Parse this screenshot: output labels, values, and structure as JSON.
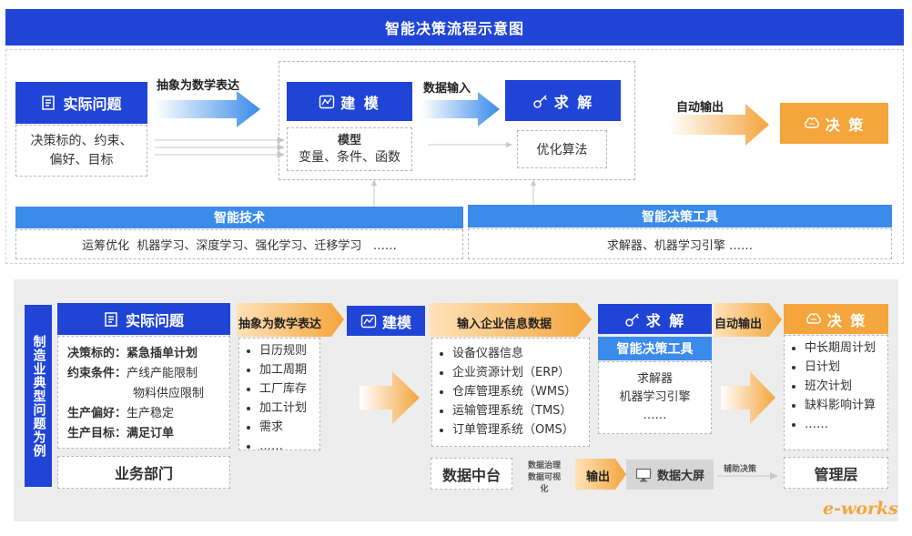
{
  "title": "智能决策流程示意图",
  "top": {
    "real_problem": {
      "title": "实际问题",
      "body_line1": "决策标的、约束、",
      "body_line2": "偏好、目标"
    },
    "abstract_label": "抽象为数学表达",
    "modeling": {
      "title": "建 模",
      "sub_title": "模型",
      "sub_body": "变量、条件、函数"
    },
    "data_input_label": "数据输入",
    "solve": {
      "title": "求 解",
      "body": "优化算法"
    },
    "auto_output_label": "自动输出",
    "decision": {
      "title": "决 策"
    },
    "smart_tech": {
      "title": "智能技术",
      "body": "运筹优化  机器学习、深度学习、强化学习、迁移学习   ……"
    },
    "smart_tools": {
      "title": "智能决策工具",
      "body": "求解器、机器学习引擎 ……"
    }
  },
  "bottom": {
    "side_label": "制造业典型问题为例",
    "real_problem": {
      "title": "实际问题",
      "rows": [
        {
          "label": "决策标的：",
          "value": "紧急插单计划"
        },
        {
          "label": "约束条件：",
          "value": "产线产能限制"
        },
        {
          "label": "",
          "value": "物料供应限制"
        },
        {
          "label": "生产偏好：",
          "value": "生产稳定"
        },
        {
          "label": "生产目标：",
          "value": "满足订单"
        }
      ]
    },
    "dept": "业务部门",
    "abstract_label": "抽象为数学表达",
    "abstract_items": [
      "日历规则",
      "加工周期",
      "工厂库存",
      "加工计划",
      "需求",
      "……"
    ],
    "modeling_title": "建模",
    "enterprise_label": "输入企业信息数据",
    "enterprise_items": [
      "设备仪器信息",
      "企业资源计划（ERP）",
      "仓库管理系统（WMS）",
      "运输管理系统（TMS）",
      "订单管理系统（OMS）"
    ],
    "data_center": "数据中台",
    "data_gov_line1": "数据治理",
    "data_gov_line2": "数据可视",
    "data_gov_line3": "化",
    "output_label": "输出",
    "big_screen": "数据大屏",
    "assist_label": "辅助决策",
    "solve_title": "求 解",
    "tools_title": "智能决策工具",
    "tools_items": [
      "求解器",
      "机器学习引擎",
      "……"
    ],
    "auto_output_label": "自动输出",
    "decision_title": "决 策",
    "decision_items": [
      "中长期周计划",
      "日计划",
      "班次计划",
      "缺料影响计算",
      "……"
    ],
    "mgmt": "管理层"
  },
  "watermark": "e-works",
  "colors": {
    "blue": "#1f44d6",
    "light_blue": "#3a8bea",
    "orange": "#f4a53b",
    "gray_bg": "#ededed"
  }
}
